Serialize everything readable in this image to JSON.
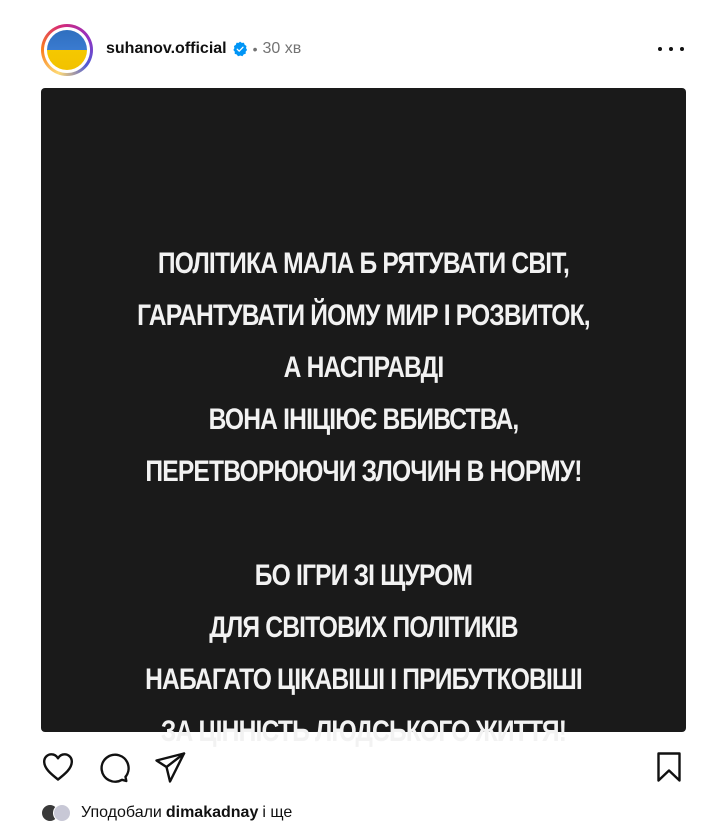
{
  "post": {
    "username": "suhanov.official",
    "separator": "•",
    "time": "30 хв",
    "media_text": {
      "block1": [
        "ПОЛІТИКА МАЛА Б РЯТУВАТИ СВІТ,",
        "ГАРАНТУВАТИ ЙОМУ МИР І РОЗВИТОК,",
        "А НАСПРАВДІ",
        "ВОНА ІНІЦІЮЄ ВБИВСТВА,",
        "ПЕРЕТВОРЮЮЧИ ЗЛОЧИН В НОРМУ!"
      ],
      "block2": [
        "БО ІГРИ ЗІ ЩУРОМ",
        "ДЛЯ СВІТОВИХ ПОЛІТИКІВ",
        "НАБАГАТО ЦІКАВІШІ І ПРИБУТКОВІШІ",
        "ЗА ЦІННІСТЬ ЛЮДСЬКОГО ЖИТТЯ!"
      ]
    },
    "likes": {
      "prefix": "Уподобали",
      "name": "dimakadnay",
      "suffix": "і ще"
    },
    "icons": {
      "verified": "verified-badge-icon",
      "more": "more-options-icon",
      "like": "heart-icon",
      "comment": "comment-icon",
      "share": "share-icon",
      "save": "bookmark-icon"
    },
    "colors": {
      "verified": "#0095f6",
      "media_background": "#1a1a1a",
      "media_text": "#f2f2f2",
      "muted_text": "#737373",
      "avatar_flag_top": "#2f6fbf",
      "avatar_flag_bottom": "#f5c800"
    }
  }
}
